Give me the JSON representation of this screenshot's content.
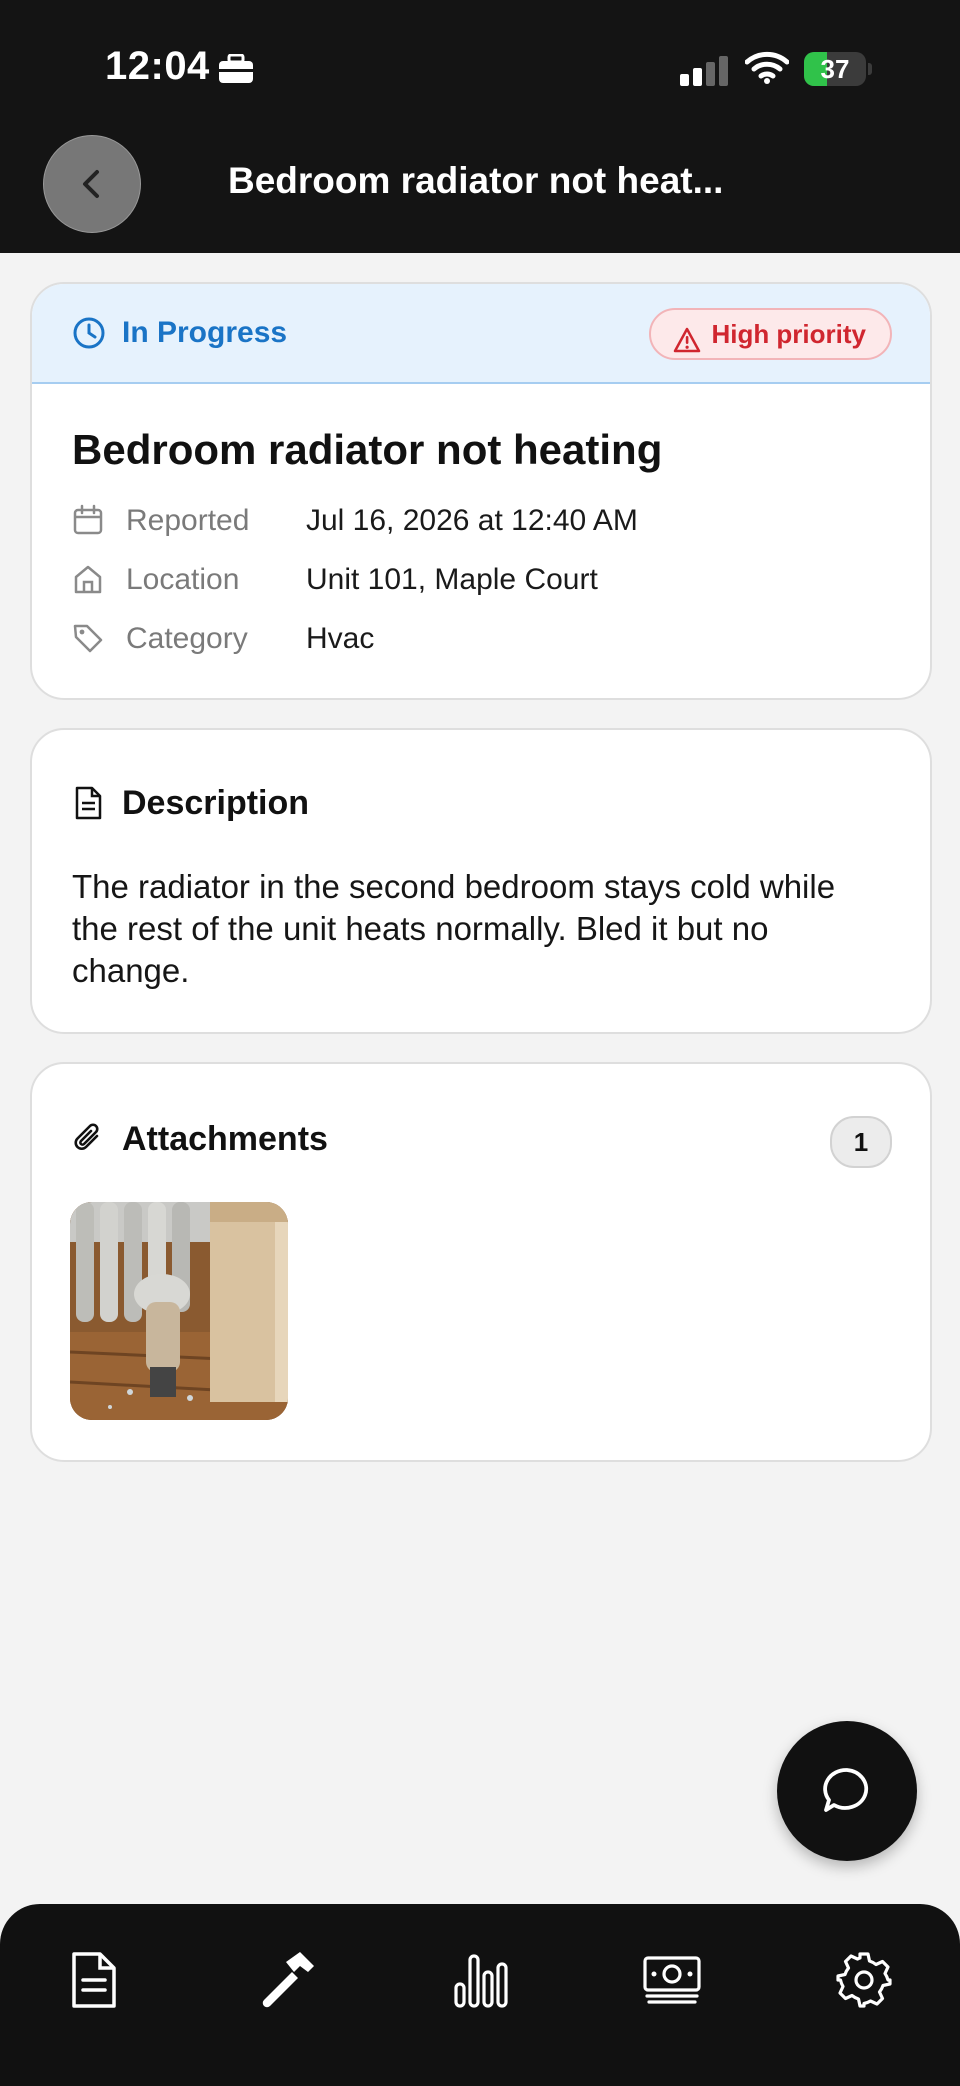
{
  "status_bar": {
    "time": "12:04",
    "battery": "37",
    "battery_level": 0.37
  },
  "header": {
    "title": "Bedroom radiator not heat..."
  },
  "issue": {
    "status": "In Progress",
    "priority": "High priority",
    "title": "Bedroom radiator not heating",
    "meta": [
      {
        "icon": "calendar-icon",
        "label": "Reported",
        "value": "Jul 16, 2026 at 12:40 AM"
      },
      {
        "icon": "home-icon",
        "label": "Location",
        "value": "Unit 101, Maple Court"
      },
      {
        "icon": "tag-icon",
        "label": "Category",
        "value": "Hvac"
      }
    ]
  },
  "description": {
    "heading": "Description",
    "text": "The radiator in the second bedroom stays cold while the rest of the unit heats normally. Bled it but no change."
  },
  "attachments": {
    "heading": "Attachments",
    "count": "1",
    "items": [
      {
        "type": "photo",
        "subject": "radiator"
      }
    ]
  },
  "tabs": [
    {
      "icon": "document-icon"
    },
    {
      "icon": "hammer-icon"
    },
    {
      "icon": "bar-chart-icon"
    },
    {
      "icon": "money-icon"
    },
    {
      "icon": "gear-icon"
    }
  ],
  "colors": {
    "status_blue": "#1a74c6",
    "priority_red": "#d0262f",
    "battery_green": "#30c24a"
  }
}
